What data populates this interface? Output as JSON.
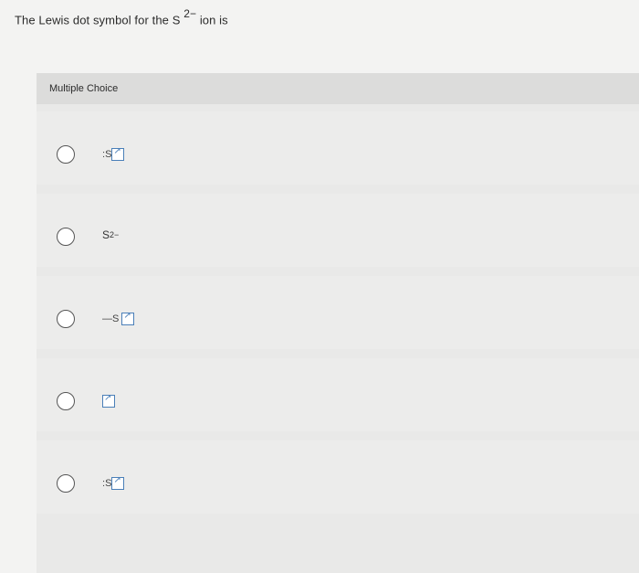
{
  "question": {
    "prefix": "The Lewis dot symbol for the S",
    "superscript": "2−",
    "suffix": "ion is"
  },
  "panel": {
    "header": "Multiple Choice"
  },
  "choices": [
    {
      "kind": "image",
      "prefix_text": ":",
      "letter": "S"
    },
    {
      "kind": "text",
      "letter": "S",
      "superscript": "2−"
    },
    {
      "kind": "image",
      "prefix_text": "—",
      "letter": "S",
      "suffix_text": ""
    },
    {
      "kind": "image",
      "prefix_text": "",
      "letter": "",
      "suffix_text": ""
    },
    {
      "kind": "image",
      "prefix_text": ":",
      "letter": "S",
      "suffix_text": ""
    }
  ],
  "colors": {
    "background": "#f3f3f2",
    "panel": "#e9e9e8",
    "panel_header": "#dcdcdb",
    "image_icon": "#4a7fb8"
  }
}
